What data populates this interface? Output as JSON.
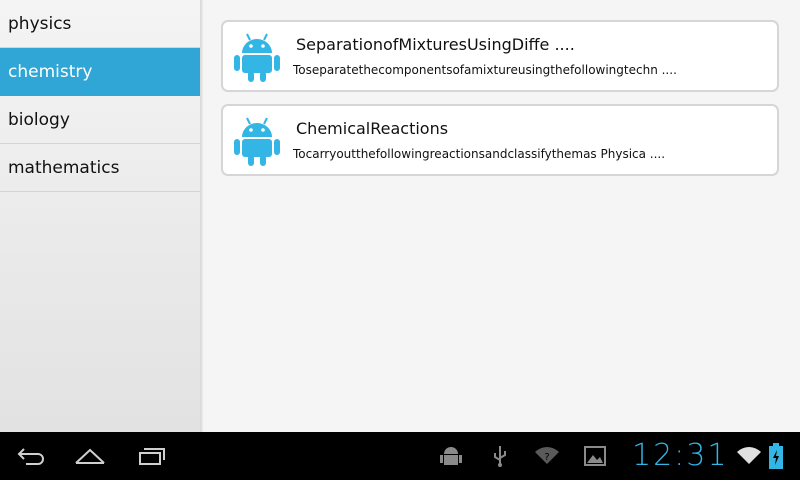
{
  "sidebar": {
    "items": [
      {
        "label": "physics"
      },
      {
        "label": "chemistry"
      },
      {
        "label": "biology"
      },
      {
        "label": "mathematics"
      }
    ],
    "selected_index": 1
  },
  "main": {
    "cards": [
      {
        "title": "SeparationofMixturesUsingDiffe ....",
        "description": "Toseparatethecomponentsofamixtureusingthefollowingtechn ....",
        "icon": "android-robot-icon"
      },
      {
        "title": "ChemicalReactions",
        "description": "Tocarryoutthefollowingreactionsandclassifythemas Physica ....",
        "icon": "android-robot-icon"
      }
    ]
  },
  "status_bar": {
    "time": "12:31",
    "icons": [
      "back-icon",
      "home-icon",
      "recent-apps-icon",
      "android-debug-icon",
      "usb-icon",
      "no-signal-icon",
      "gallery-icon",
      "wifi-icon",
      "battery-charging-icon"
    ]
  },
  "colors": {
    "accent": "#2fa6d5",
    "android_green": "#33b5e5",
    "clock": "#33b5e5"
  }
}
